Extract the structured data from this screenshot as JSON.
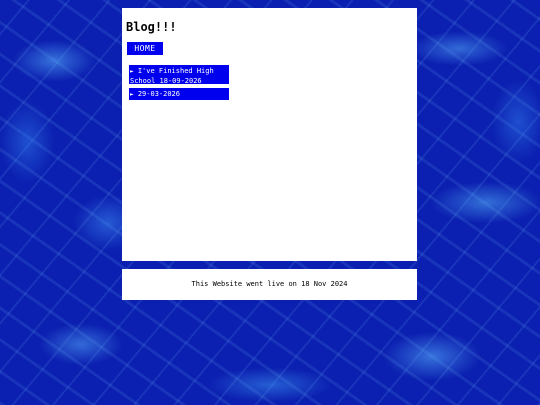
{
  "header": {
    "title": "Blog!!!"
  },
  "nav": {
    "home_label": "HOME"
  },
  "posts": [
    {
      "marker": "►",
      "title": "I've Finished High School 18-09-2026"
    },
    {
      "marker": "►",
      "title": "29-03-2026"
    }
  ],
  "footer": {
    "text": "This Website went live on 18 Nov 2024"
  },
  "colors": {
    "background": "#0b1fb0",
    "panel": "#ffffff",
    "link_box": "#0000ee",
    "link_text": "#ffffff"
  }
}
